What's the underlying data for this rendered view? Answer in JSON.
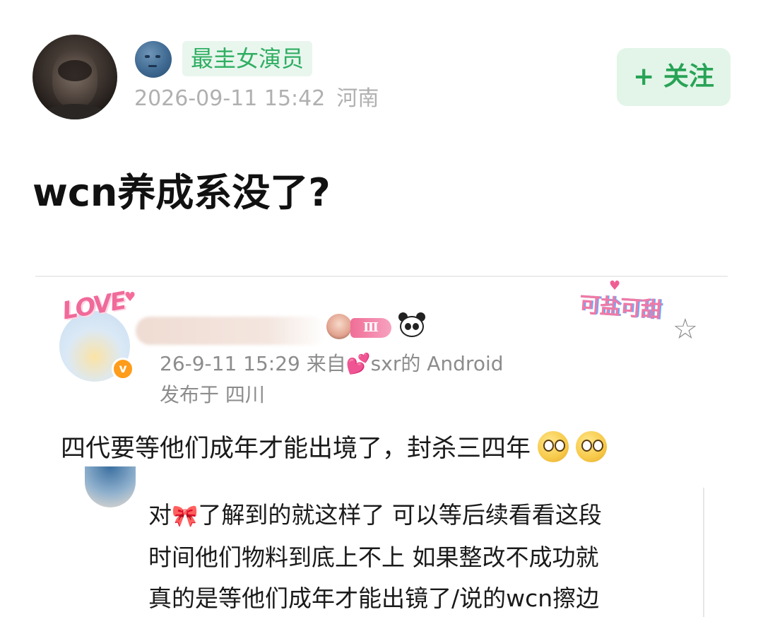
{
  "post": {
    "badge": "最圭女演员",
    "time": "2026-09-11 15:42",
    "location": "河南",
    "follow_label": "+ 关注",
    "title": "wcn养成系没了?"
  },
  "embedded": {
    "love_text": "LOVE",
    "level_label": "Ⅲ",
    "sticker_text": "可盐可甜",
    "vip_mark": "v",
    "meta_time": "26-9-11 15:29",
    "meta_from": "来自",
    "meta_device": "sxr的 Android",
    "meta_location": "发布于 四川",
    "body": "四代要等他们成年才能出境了，封杀三四年",
    "reply_prefix": "对",
    "reply_line1_rest": "了解到的就这样了 可以等后续看看这段",
    "reply_line2": "时间他们物料到底上不上 如果整改不成功就",
    "reply_line3": "真的是等他们成年才能出镜了/说的wcn擦边"
  },
  "icons": {
    "star": "star-outline-icon",
    "panda": "panda-icon",
    "moon": "moon-face-icon",
    "heart": "heart-icon",
    "bow": "bow-icon",
    "flushed": "flushed-face-icon"
  },
  "colors": {
    "accent_green": "#2fae62",
    "follow_bg": "#e2f5e8",
    "meta_gray": "#b0b0b0",
    "pink": "#f06a9a"
  }
}
